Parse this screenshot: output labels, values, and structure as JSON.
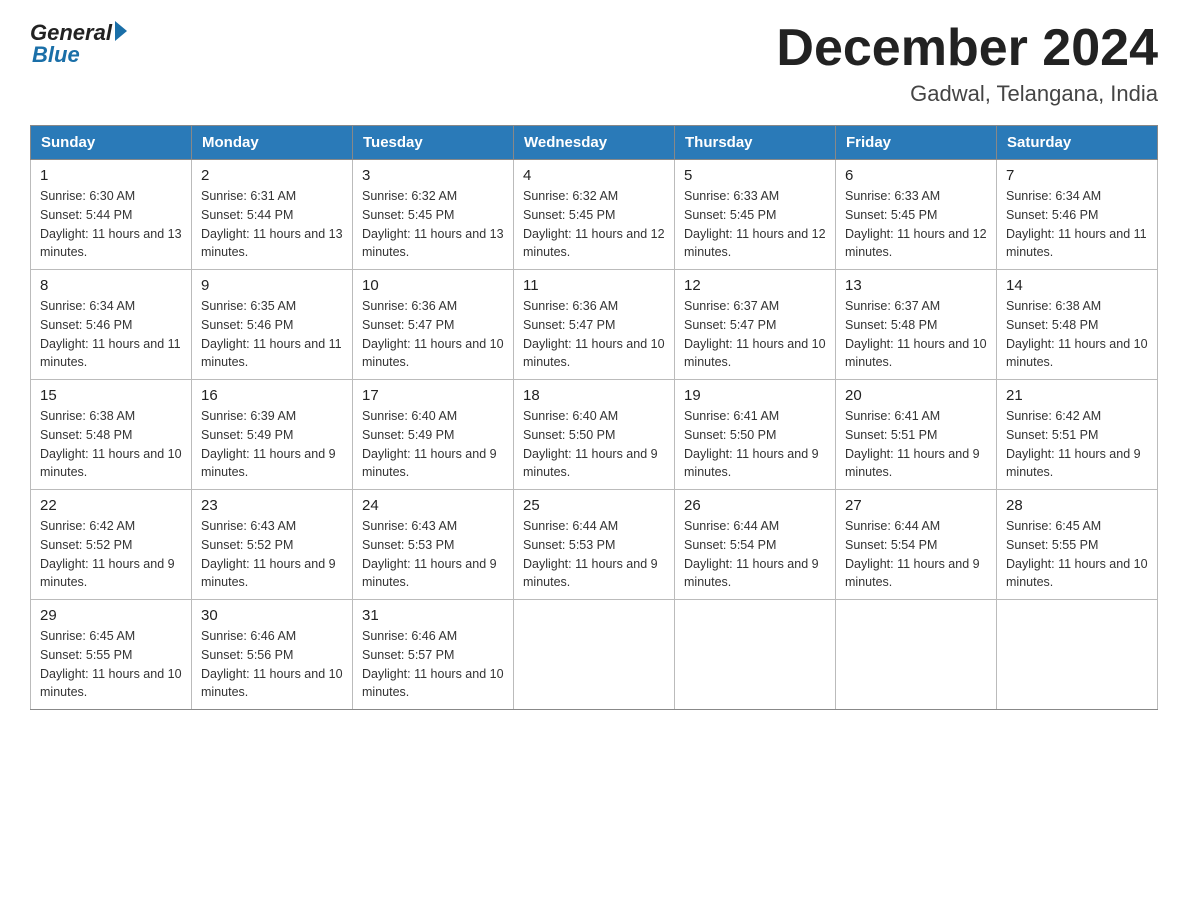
{
  "logo": {
    "general": "General",
    "blue": "Blue"
  },
  "title": "December 2024",
  "location": "Gadwal, Telangana, India",
  "days_of_week": [
    "Sunday",
    "Monday",
    "Tuesday",
    "Wednesday",
    "Thursday",
    "Friday",
    "Saturday"
  ],
  "weeks": [
    [
      {
        "day": "1",
        "sunrise": "6:30 AM",
        "sunset": "5:44 PM",
        "daylight": "11 hours and 13 minutes."
      },
      {
        "day": "2",
        "sunrise": "6:31 AM",
        "sunset": "5:44 PM",
        "daylight": "11 hours and 13 minutes."
      },
      {
        "day": "3",
        "sunrise": "6:32 AM",
        "sunset": "5:45 PM",
        "daylight": "11 hours and 13 minutes."
      },
      {
        "day": "4",
        "sunrise": "6:32 AM",
        "sunset": "5:45 PM",
        "daylight": "11 hours and 12 minutes."
      },
      {
        "day": "5",
        "sunrise": "6:33 AM",
        "sunset": "5:45 PM",
        "daylight": "11 hours and 12 minutes."
      },
      {
        "day": "6",
        "sunrise": "6:33 AM",
        "sunset": "5:45 PM",
        "daylight": "11 hours and 12 minutes."
      },
      {
        "day": "7",
        "sunrise": "6:34 AM",
        "sunset": "5:46 PM",
        "daylight": "11 hours and 11 minutes."
      }
    ],
    [
      {
        "day": "8",
        "sunrise": "6:34 AM",
        "sunset": "5:46 PM",
        "daylight": "11 hours and 11 minutes."
      },
      {
        "day": "9",
        "sunrise": "6:35 AM",
        "sunset": "5:46 PM",
        "daylight": "11 hours and 11 minutes."
      },
      {
        "day": "10",
        "sunrise": "6:36 AM",
        "sunset": "5:47 PM",
        "daylight": "11 hours and 10 minutes."
      },
      {
        "day": "11",
        "sunrise": "6:36 AM",
        "sunset": "5:47 PM",
        "daylight": "11 hours and 10 minutes."
      },
      {
        "day": "12",
        "sunrise": "6:37 AM",
        "sunset": "5:47 PM",
        "daylight": "11 hours and 10 minutes."
      },
      {
        "day": "13",
        "sunrise": "6:37 AM",
        "sunset": "5:48 PM",
        "daylight": "11 hours and 10 minutes."
      },
      {
        "day": "14",
        "sunrise": "6:38 AM",
        "sunset": "5:48 PM",
        "daylight": "11 hours and 10 minutes."
      }
    ],
    [
      {
        "day": "15",
        "sunrise": "6:38 AM",
        "sunset": "5:48 PM",
        "daylight": "11 hours and 10 minutes."
      },
      {
        "day": "16",
        "sunrise": "6:39 AM",
        "sunset": "5:49 PM",
        "daylight": "11 hours and 9 minutes."
      },
      {
        "day": "17",
        "sunrise": "6:40 AM",
        "sunset": "5:49 PM",
        "daylight": "11 hours and 9 minutes."
      },
      {
        "day": "18",
        "sunrise": "6:40 AM",
        "sunset": "5:50 PM",
        "daylight": "11 hours and 9 minutes."
      },
      {
        "day": "19",
        "sunrise": "6:41 AM",
        "sunset": "5:50 PM",
        "daylight": "11 hours and 9 minutes."
      },
      {
        "day": "20",
        "sunrise": "6:41 AM",
        "sunset": "5:51 PM",
        "daylight": "11 hours and 9 minutes."
      },
      {
        "day": "21",
        "sunrise": "6:42 AM",
        "sunset": "5:51 PM",
        "daylight": "11 hours and 9 minutes."
      }
    ],
    [
      {
        "day": "22",
        "sunrise": "6:42 AM",
        "sunset": "5:52 PM",
        "daylight": "11 hours and 9 minutes."
      },
      {
        "day": "23",
        "sunrise": "6:43 AM",
        "sunset": "5:52 PM",
        "daylight": "11 hours and 9 minutes."
      },
      {
        "day": "24",
        "sunrise": "6:43 AM",
        "sunset": "5:53 PM",
        "daylight": "11 hours and 9 minutes."
      },
      {
        "day": "25",
        "sunrise": "6:44 AM",
        "sunset": "5:53 PM",
        "daylight": "11 hours and 9 minutes."
      },
      {
        "day": "26",
        "sunrise": "6:44 AM",
        "sunset": "5:54 PM",
        "daylight": "11 hours and 9 minutes."
      },
      {
        "day": "27",
        "sunrise": "6:44 AM",
        "sunset": "5:54 PM",
        "daylight": "11 hours and 9 minutes."
      },
      {
        "day": "28",
        "sunrise": "6:45 AM",
        "sunset": "5:55 PM",
        "daylight": "11 hours and 10 minutes."
      }
    ],
    [
      {
        "day": "29",
        "sunrise": "6:45 AM",
        "sunset": "5:55 PM",
        "daylight": "11 hours and 10 minutes."
      },
      {
        "day": "30",
        "sunrise": "6:46 AM",
        "sunset": "5:56 PM",
        "daylight": "11 hours and 10 minutes."
      },
      {
        "day": "31",
        "sunrise": "6:46 AM",
        "sunset": "5:57 PM",
        "daylight": "11 hours and 10 minutes."
      },
      null,
      null,
      null,
      null
    ]
  ]
}
